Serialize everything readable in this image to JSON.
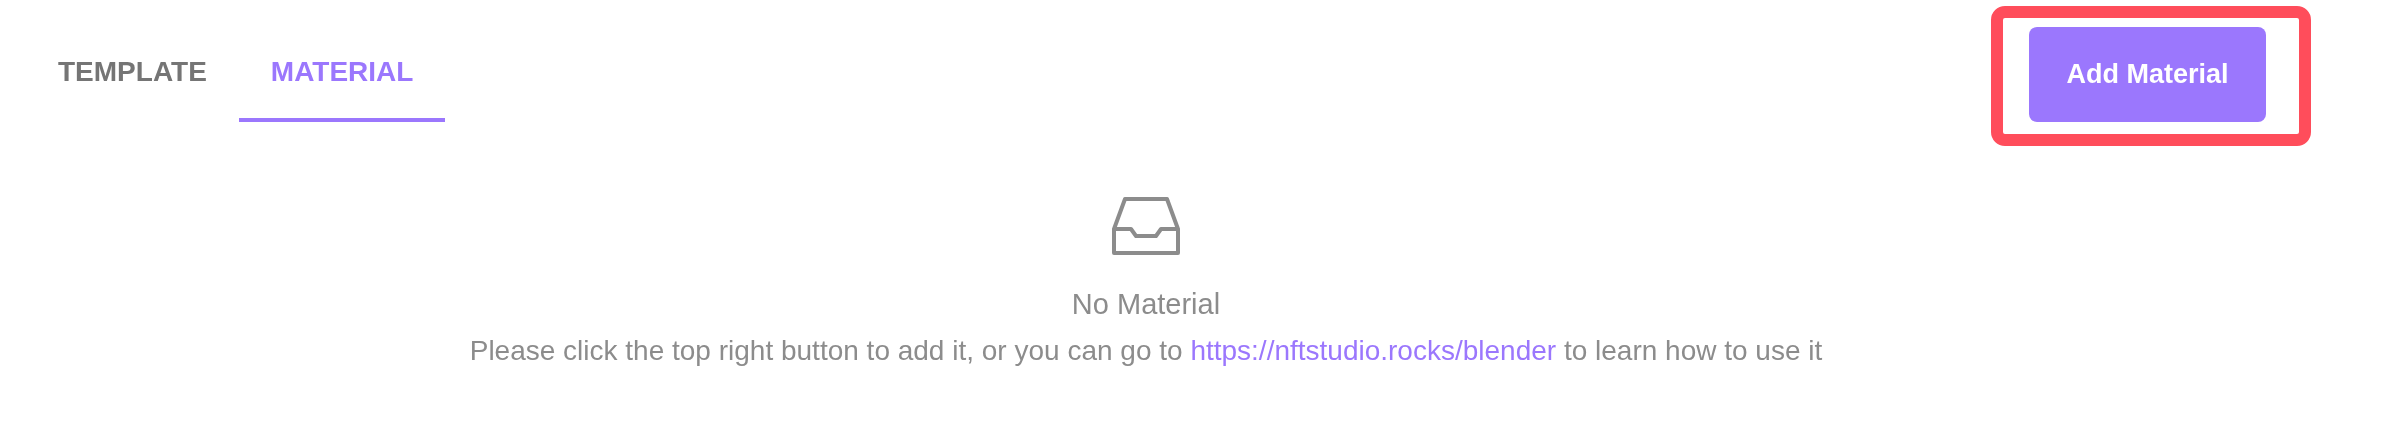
{
  "tabs": [
    {
      "label": "TEMPLATE",
      "selected": false
    },
    {
      "label": "MATERIAL",
      "selected": true
    }
  ],
  "add_button": {
    "label": "Add Material",
    "highlighted": true
  },
  "empty_state": {
    "title": "No Material",
    "message_before": "Please click the top right button to add it, or you can go to",
    "link": "https://nftstudio.rocks/blender",
    "message_after": "to learn how to use it"
  }
}
